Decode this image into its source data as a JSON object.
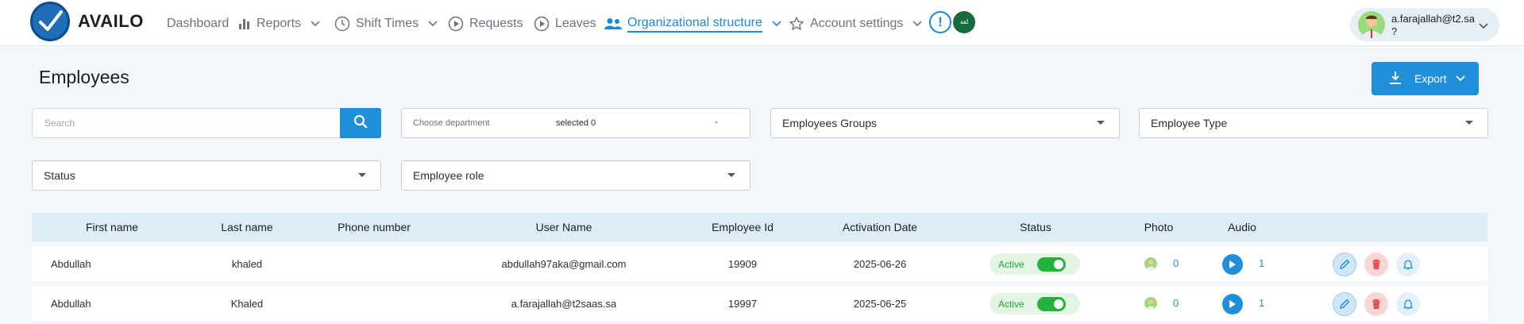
{
  "app": {
    "name": "AVAILO"
  },
  "nav": {
    "items": [
      {
        "label": "Dashboard",
        "icon": ""
      },
      {
        "label": "Reports",
        "icon": "bar-chart-icon"
      },
      {
        "label": "Shift Times",
        "icon": "clock-icon"
      },
      {
        "label": "Requests",
        "icon": "play-circle-icon"
      },
      {
        "label": "Leaves",
        "icon": "play-circle-icon"
      },
      {
        "label": "Organizational structure",
        "icon": "people-icon",
        "active": true
      },
      {
        "label": "Account settings",
        "icon": "star-icon"
      }
    ],
    "alert_glyph": "!",
    "flag_text": "لغة"
  },
  "user": {
    "email": "a.farajallah@t2.sa",
    "sub": "?"
  },
  "page": {
    "title": "Employees",
    "export_label": "Export"
  },
  "filters": {
    "search_placeholder": "Search",
    "department_placeholder": "Choose department",
    "department_selected": "selected 0",
    "department_dash": "-",
    "employees_groups": "Employees Groups",
    "employee_type": "Employee Type",
    "status": "Status",
    "employee_role": "Employee role"
  },
  "table": {
    "headers": [
      "First name",
      "Last name",
      "Phone number",
      "User Name",
      "Employee Id",
      "Activation Date",
      "Status",
      "Photo",
      "Audio"
    ],
    "rows": [
      {
        "first_name": "Abdullah",
        "last_name": "khaled",
        "phone": "",
        "username": "abdullah97aka@gmail.com",
        "employee_id": "19909",
        "activation_date": "2025-06-26",
        "status": "Active",
        "active": true,
        "photo_count": "0",
        "audio_count": "1"
      },
      {
        "first_name": "Abdullah",
        "last_name": "Khaled",
        "phone": "",
        "username": "a.farajallah@t2saas.sa",
        "employee_id": "19997",
        "activation_date": "2025-06-25",
        "status": "Active",
        "active": true,
        "photo_count": "0",
        "audio_count": "1"
      }
    ]
  },
  "colors": {
    "accent": "#1e8fd8",
    "active_green": "#23b23c",
    "header_bg": "#dcedf8",
    "page_bg": "#f3f7fc"
  }
}
